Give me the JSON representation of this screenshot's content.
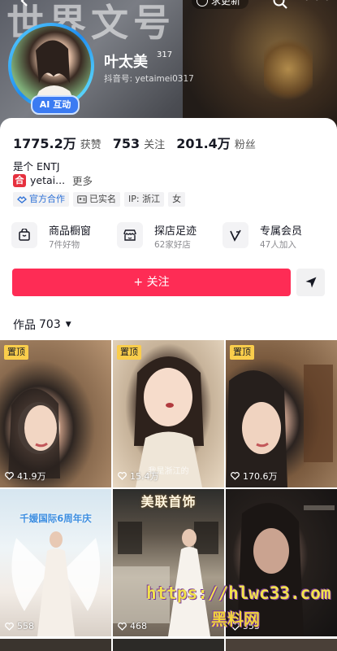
{
  "header": {
    "banner_text": "世界文号",
    "update_label": "求更新",
    "more_label": "•••"
  },
  "profile": {
    "name": "叶太美",
    "name_sup": "317",
    "douyin_id": "抖音号: yetaimei0317",
    "ai_badge": "AI 互动"
  },
  "stats": [
    {
      "value": "1775.2万",
      "label": "获赞"
    },
    {
      "value": "753",
      "label": "关注"
    },
    {
      "value": "201.4万",
      "label": "粉丝"
    }
  ],
  "bio": "是个 ENTJ",
  "link": {
    "icon_text": "合",
    "text": "yetai...",
    "more": "更多"
  },
  "tags": [
    {
      "text": "官方合作",
      "icon": "handshake-icon"
    },
    {
      "text": "已实名",
      "icon": "id-card-icon"
    },
    {
      "text": "IP: 浙江",
      "icon": ""
    },
    {
      "text": "女",
      "icon": ""
    }
  ],
  "features": [
    {
      "title": "商品橱窗",
      "sub": "7件好物",
      "icon": "shopping-bag-icon"
    },
    {
      "title": "探店足迹",
      "sub": "62家好店",
      "icon": "store-icon"
    },
    {
      "title": "专属会员",
      "sub": "47人加入",
      "icon": "vip-icon"
    }
  ],
  "follow_label": "+ 关注",
  "works": {
    "label": "作品",
    "count": "703"
  },
  "tiles": [
    {
      "pinned": "置顶",
      "likes": "41.9万",
      "caption": "",
      "sub": ""
    },
    {
      "pinned": "置顶",
      "likes": "15.4万",
      "caption": "",
      "sub": "我是浙江的"
    },
    {
      "pinned": "置顶",
      "likes": "170.6万",
      "caption": "",
      "sub": ""
    },
    {
      "pinned": "",
      "likes": "558",
      "caption": "千媛国际6周年庆",
      "sub": ""
    },
    {
      "pinned": "",
      "likes": "468",
      "caption": "美联首饰",
      "sub": ""
    },
    {
      "pinned": "",
      "likes": "555",
      "caption": "",
      "sub": ""
    }
  ],
  "watermark": {
    "url": "https://hlwc33.com",
    "name": "黑料网"
  },
  "colors": {
    "accent": "#fe2c55",
    "pin": "#facd4b",
    "ai_badge": "#3b7bf2"
  }
}
